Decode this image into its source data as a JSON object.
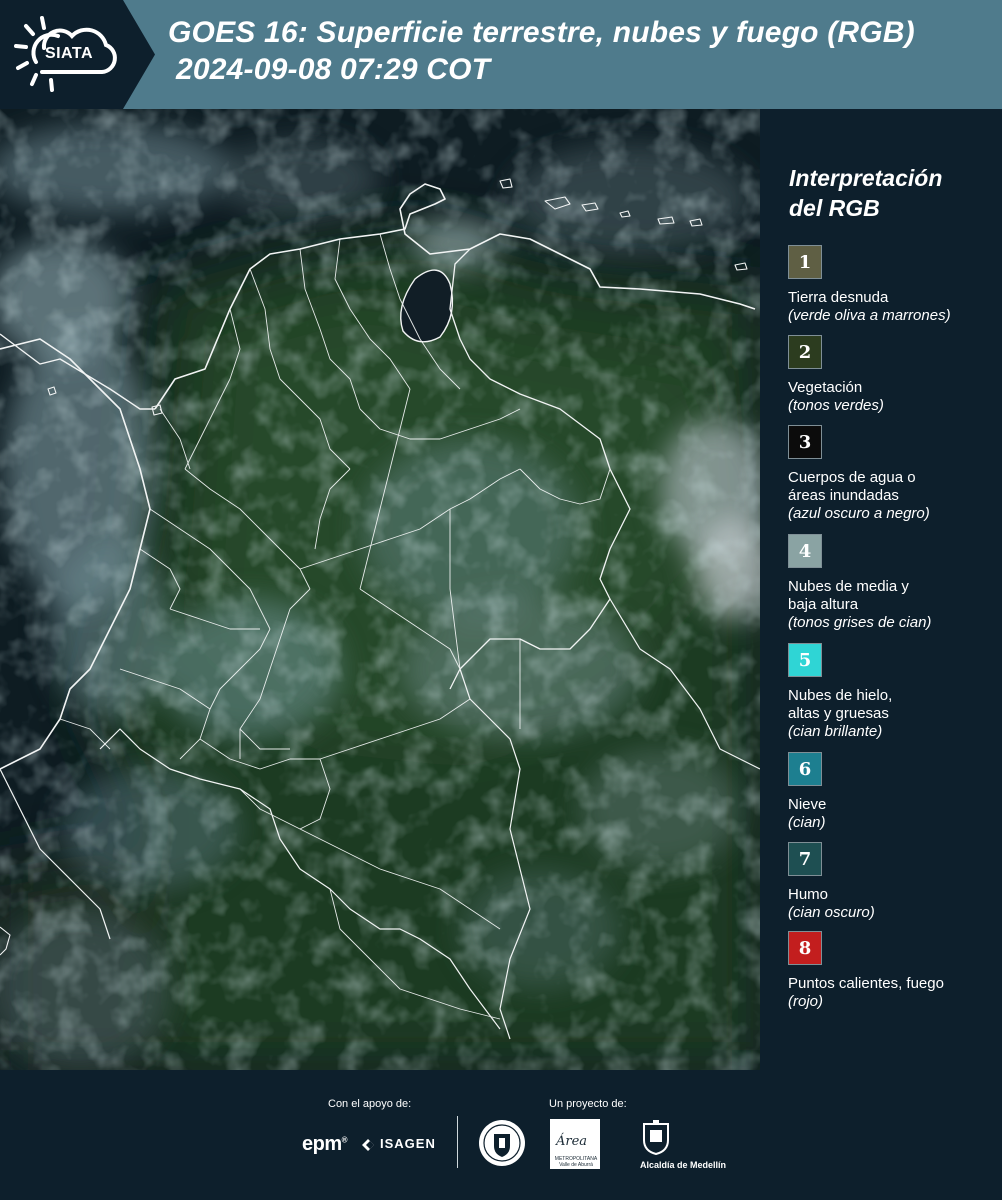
{
  "header": {
    "logo_text": "SIATA",
    "title_line1": "GOES 16: Superficie terrestre, nubes y fuego (RGB)",
    "title_line2": "2024-09-08 07:29 COT"
  },
  "colors": {
    "header_dark": "#0d1f2c",
    "header_band": "#4f7b8c",
    "legend_bg": "#0b1d2a",
    "map_base": "#0e1c22",
    "boundary": "#f2f4f4"
  },
  "legend": {
    "title_lines": [
      "Interpretación",
      "del RGB"
    ],
    "items": [
      {
        "number": "1",
        "color": "#5f5f44",
        "label": [
          "Tierra desnuda"
        ],
        "note": "(verde oliva a marrones)"
      },
      {
        "number": "2",
        "color": "#2c3c1f",
        "label": [
          "Vegetación"
        ],
        "note": "(tonos verdes)"
      },
      {
        "number": "3",
        "color": "#0c0c0c",
        "label": [
          "Cuerpos de agua o",
          "áreas inundadas"
        ],
        "note": "(azul oscuro a negro)"
      },
      {
        "number": "4",
        "color": "#8aa3a3",
        "label": [
          "Nubes de media y",
          "baja altura"
        ],
        "note": "(tonos grises de cian)"
      },
      {
        "number": "5",
        "color": "#2fd5d5",
        "label": [
          "Nubes de hielo,",
          "altas y gruesas"
        ],
        "note": "(cian brillante)"
      },
      {
        "number": "6",
        "color": "#1d7f90",
        "label": [
          "Nieve"
        ],
        "note": "(cian)"
      },
      {
        "number": "7",
        "color": "#1e4f52",
        "label": [
          "Humo"
        ],
        "note": "(cian oscuro)"
      },
      {
        "number": "8",
        "color": "#c31e1e",
        "label": [
          "Puntos calientes, fuego"
        ],
        "note": "(rojo)"
      }
    ]
  },
  "footer": {
    "support_label": "Con el apoyo de:",
    "project_label": "Un proyecto de:",
    "logos": {
      "epm": "epm",
      "isagen": "ISAGEN",
      "area_metropolitana": "Área",
      "area_sub": "METROPOLITANA Valle de Aburrá",
      "medellin": "Alcaldía de Medellín"
    }
  }
}
